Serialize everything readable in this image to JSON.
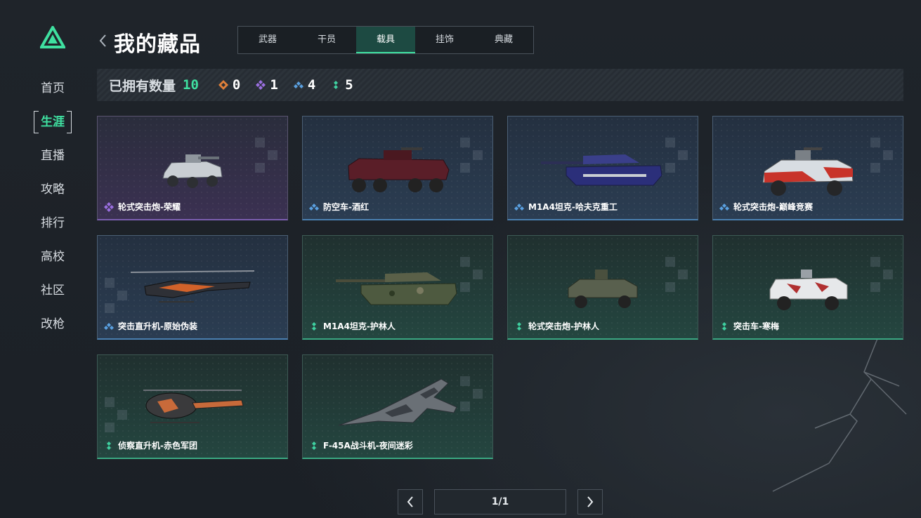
{
  "colors": {
    "accent": "#3fe0a0",
    "rarity_orange": "#e0803a",
    "rarity_purple": "#9a6fe0",
    "rarity_blue": "#5aa0e0",
    "rarity_green": "#3fd0a0"
  },
  "sidebar": {
    "logo_icon": "triangle-logo-icon",
    "items": [
      {
        "label": "首页"
      },
      {
        "label": "生涯",
        "active": true
      },
      {
        "label": "直播"
      },
      {
        "label": "攻略"
      },
      {
        "label": "排行"
      },
      {
        "label": "高校"
      },
      {
        "label": "社区"
      },
      {
        "label": "改枪"
      }
    ]
  },
  "header": {
    "title": "我的藏品",
    "tabs": [
      {
        "label": "武器"
      },
      {
        "label": "干员"
      },
      {
        "label": "载具",
        "active": true
      },
      {
        "label": "挂饰"
      },
      {
        "label": "典藏"
      }
    ]
  },
  "stats": {
    "label": "已拥有数量",
    "total": "10",
    "counts": [
      {
        "rarity": "orange",
        "icon": "orange-diamond-icon",
        "value": "0"
      },
      {
        "rarity": "purple",
        "icon": "purple-diamond-icon",
        "value": "1"
      },
      {
        "rarity": "blue",
        "icon": "blue-diamond-icon",
        "value": "4"
      },
      {
        "rarity": "green",
        "icon": "green-diamond-icon",
        "value": "5"
      }
    ]
  },
  "vehicles": [
    {
      "name": "轮式突击炮-荣耀",
      "rarity": "purple",
      "icon": "armored-car-icon"
    },
    {
      "name": "防空车-酒红",
      "rarity": "blue",
      "icon": "apc-icon"
    },
    {
      "name": "M1A4坦克-哈夫克重工",
      "rarity": "blue",
      "icon": "tank-icon"
    },
    {
      "name": "轮式突击炮-巅峰竞赛",
      "rarity": "blue",
      "icon": "armored-car-icon"
    },
    {
      "name": "突击直升机-原始伪装",
      "rarity": "blue",
      "icon": "attack-helicopter-icon"
    },
    {
      "name": "M1A4坦克-护林人",
      "rarity": "green",
      "icon": "tank-icon"
    },
    {
      "name": "轮式突击炮-护林人",
      "rarity": "green",
      "icon": "armored-car-icon"
    },
    {
      "name": "突击车-寒梅",
      "rarity": "green",
      "icon": "assault-vehicle-icon"
    },
    {
      "name": "侦察直升机-赤色军团",
      "rarity": "green",
      "icon": "scout-helicopter-icon"
    },
    {
      "name": "F-45A战斗机-夜间迷彩",
      "rarity": "green",
      "icon": "fighter-jet-icon"
    }
  ],
  "pagination": {
    "counter": "1/1",
    "prev_icon": "chevron-left-icon",
    "next_icon": "chevron-right-icon"
  }
}
